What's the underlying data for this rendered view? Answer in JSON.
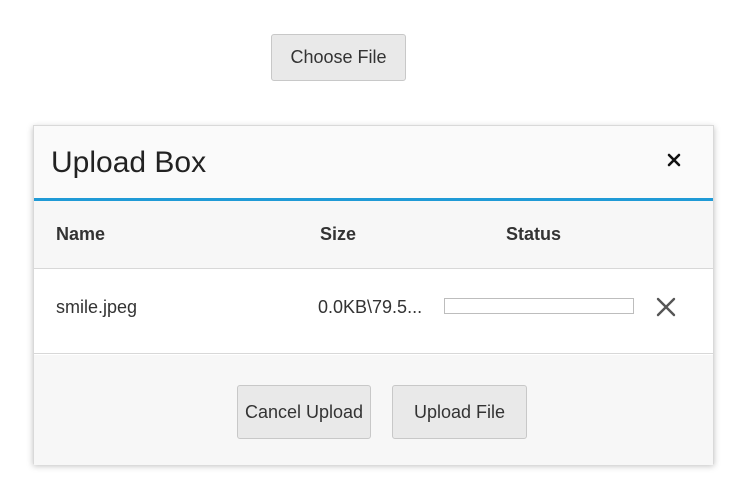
{
  "choose_button": {
    "label": "Choose File"
  },
  "dialog": {
    "title": "Upload Box",
    "columns": {
      "name": "Name",
      "size": "Size",
      "status": "Status"
    },
    "files": [
      {
        "name": "smile.jpeg",
        "size": "0.0KB\\79.5...",
        "progress": 0
      }
    ],
    "footer": {
      "cancel_label": "Cancel Upload",
      "upload_label": "Upload File"
    }
  },
  "colors": {
    "accent": "#1f9ad6",
    "button_bg": "#e9e9e9"
  },
  "icons": {
    "close": "close-icon",
    "remove": "remove-file-icon"
  }
}
